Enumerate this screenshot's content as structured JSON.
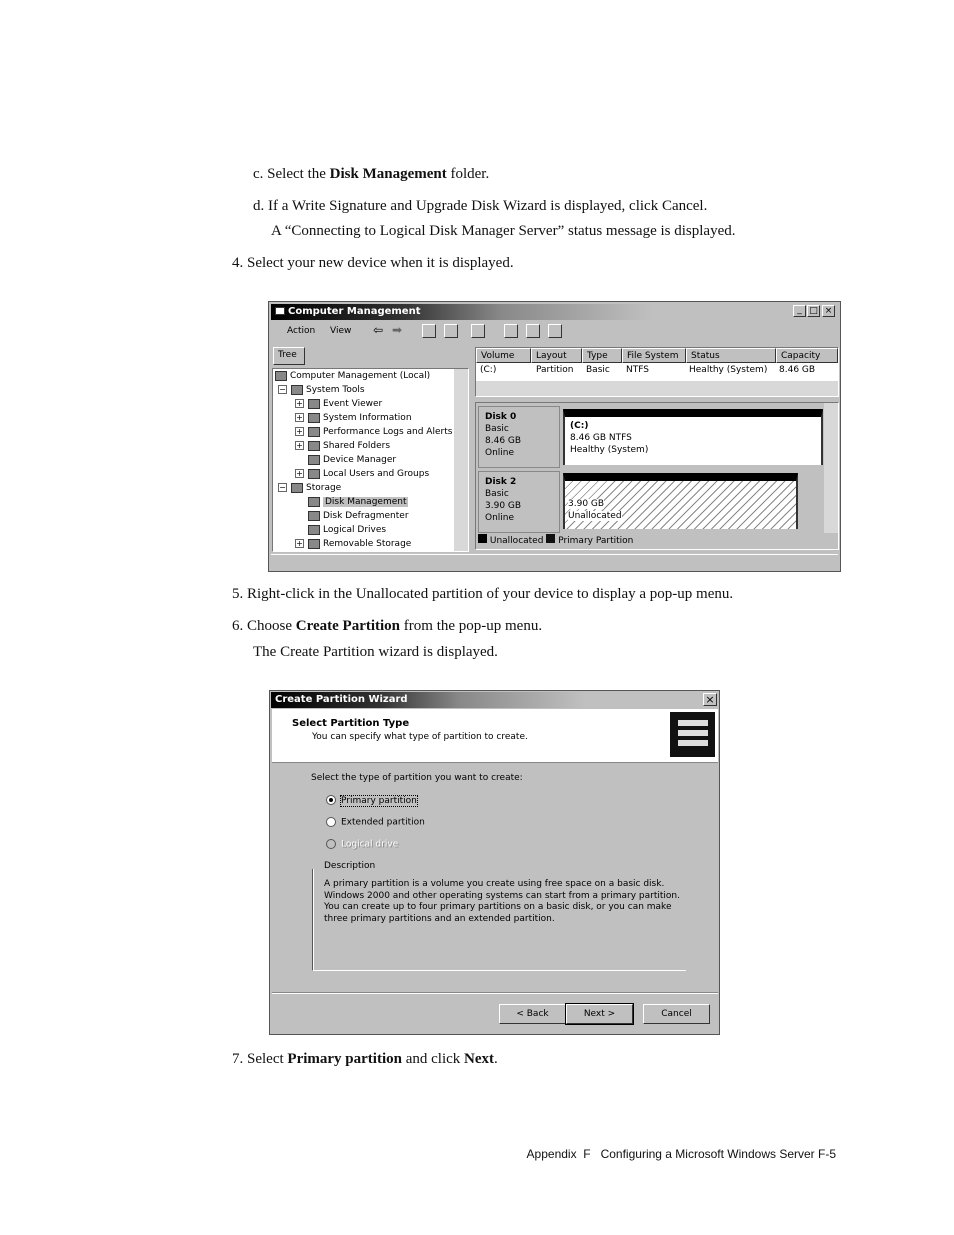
{
  "steps": {
    "c": {
      "marker": "c.",
      "pre": "Select the ",
      "bold": "Disk Management",
      "post": " folder."
    },
    "d": {
      "marker": "d.",
      "text": "If a Write Signature and Upgrade Disk Wizard is displayed, click Cancel.",
      "note": "A “Connecting to Logical Disk Manager Server” status message is displayed."
    },
    "s4": {
      "marker": "4.",
      "text": "Select your new device when it is displayed."
    },
    "s5": {
      "marker": "5.",
      "text": "Right-click in the Unallocated partition of your device to display a pop-up menu."
    },
    "s6": {
      "marker": "6.",
      "pre": "Choose ",
      "bold": "Create Partition",
      "post": " from the pop-up menu.",
      "note": "The Create Partition wizard is displayed."
    },
    "s7": {
      "marker": "7.",
      "pre": "Select ",
      "bold1": "Primary partition",
      "mid": " and click ",
      "bold2": "Next",
      "post": "."
    }
  },
  "cm": {
    "title": "Computer Management",
    "menu": [
      "Action",
      "View"
    ],
    "tree_tab": "Tree",
    "tree": [
      "Computer Management (Local)",
      "System Tools",
      "Event Viewer",
      "System Information",
      "Performance Logs and Alerts",
      "Shared Folders",
      "Device Manager",
      "Local Users and Groups",
      "Storage",
      "Disk Management",
      "Disk Defragmenter",
      "Logical Drives",
      "Removable Storage"
    ],
    "columns": [
      "Volume",
      "Layout",
      "Type",
      "File System",
      "Status",
      "Capacity"
    ],
    "row": [
      "(C:)",
      "Partition",
      "Basic",
      "NTFS",
      "Healthy (System)",
      "8.46 GB"
    ],
    "disks": [
      {
        "name": "Disk 0",
        "type": "Basic",
        "size": "8.46 GB",
        "state": "Online",
        "part_label": "(C:)",
        "part_size": "8.46 GB NTFS",
        "part_status": "Healthy (System)"
      },
      {
        "name": "Disk 2",
        "type": "Basic",
        "size": "3.90 GB",
        "state": "Online",
        "part_size": "3.90 GB",
        "part_status": "Unallocated"
      }
    ],
    "legend": [
      "Unallocated",
      "Primary Partition"
    ]
  },
  "wiz": {
    "title": "Create Partition Wizard",
    "heading": "Select Partition Type",
    "sub": "You can specify what type of partition to create.",
    "prompt": "Select the type of partition you want to create:",
    "options": [
      {
        "label": "Primary partition",
        "selected": true
      },
      {
        "label": "Extended partition",
        "selected": false
      },
      {
        "label": "Logical drive",
        "selected": false,
        "disabled": true
      }
    ],
    "desc_label": "Description",
    "desc": [
      "A primary partition is a volume you create using free space on a basic disk.",
      "Windows 2000 and other operating systems can start from a primary partition.",
      "You can create up to four primary partitions on a basic disk, or you can make",
      "three primary partitions and an extended partition."
    ],
    "back": "< Back",
    "next": "Next >",
    "cancel": "Cancel"
  },
  "footer": "Appendix  F   Configuring a Microsoft Windows Server F-5"
}
